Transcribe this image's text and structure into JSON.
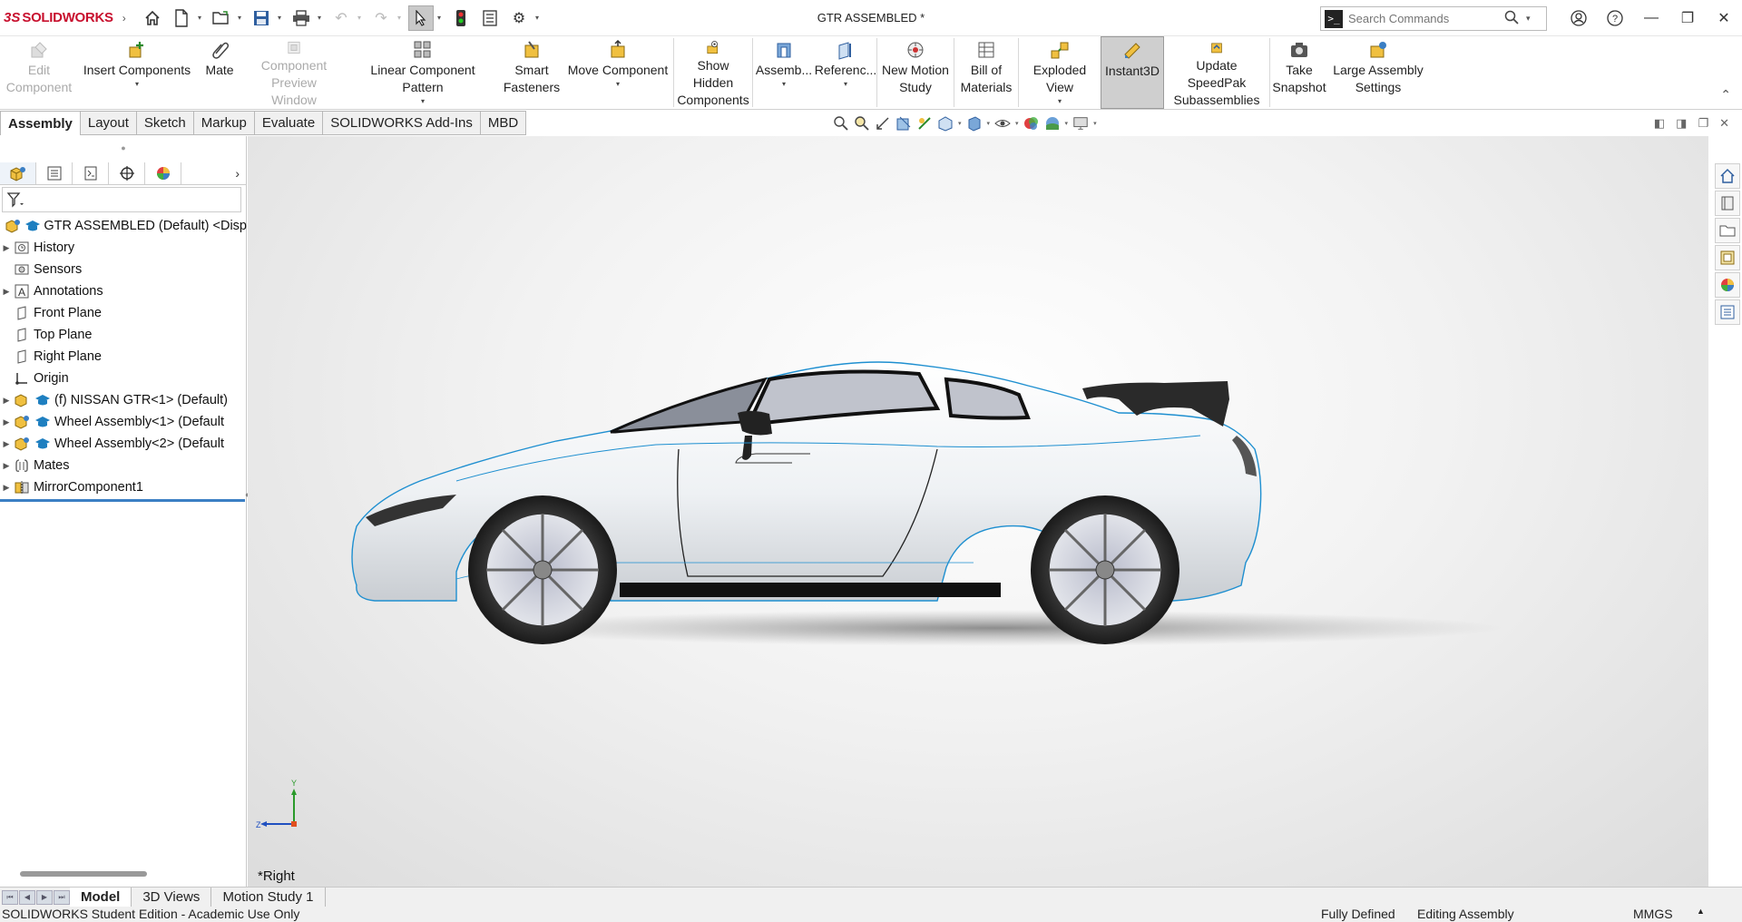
{
  "app": {
    "brand_prefix": "3S",
    "brand_name": "SOLIDWORKS",
    "document_title": "GTR ASSEMBLED *"
  },
  "search": {
    "placeholder": "Search Commands"
  },
  "ribbon": {
    "edit_component": "Edit\nComponent",
    "insert_components": "Insert Components",
    "mate": "Mate",
    "component_preview_window": "Component\nPreview Window",
    "linear_component_pattern": "Linear Component Pattern",
    "smart_fasteners": "Smart\nFasteners",
    "move_component": "Move Component",
    "show_hidden_components": "Show Hidden\nComponents",
    "assembly_features": "Assemb...",
    "reference_geometry": "Referenc...",
    "new_motion_study": "New Motion\nStudy",
    "bill_of_materials": "Bill of\nMaterials",
    "exploded_view": "Exploded View",
    "instant3d": "Instant3D",
    "update_speedpak": "Update SpeedPak\nSubassemblies",
    "take_snapshot": "Take\nSnapshot",
    "large_assembly_settings": "Large Assembly\nSettings"
  },
  "command_tabs": [
    "Assembly",
    "Layout",
    "Sketch",
    "Markup",
    "Evaluate",
    "SOLIDWORKS Add-Ins",
    "MBD"
  ],
  "tree": {
    "root": "GTR ASSEMBLED (Default) <Disp",
    "items": [
      {
        "label": "History"
      },
      {
        "label": "Sensors"
      },
      {
        "label": "Annotations"
      },
      {
        "label": "Front Plane"
      },
      {
        "label": "Top Plane"
      },
      {
        "label": "Right Plane"
      },
      {
        "label": "Origin"
      },
      {
        "label": "(f) NISSAN GTR<1> (Default)"
      },
      {
        "label": "Wheel Assembly<1> (Default"
      },
      {
        "label": "Wheel Assembly<2> (Default"
      },
      {
        "label": "Mates"
      },
      {
        "label": "MirrorComponent1"
      }
    ]
  },
  "viewport": {
    "view_name": "*Right",
    "triad": {
      "x": "Z",
      "y": "Y"
    }
  },
  "bottom_tabs": [
    "Model",
    "3D Views",
    "Motion Study 1"
  ],
  "status": {
    "edition": "SOLIDWORKS Student Edition - Academic Use Only",
    "state": "Fully Defined",
    "mode": "Editing Assembly",
    "units": "MMGS"
  },
  "colors": {
    "brand": "#c8102e",
    "edge_highlight": "#1e8fd0",
    "selection_blue": "#3b7fc4"
  }
}
